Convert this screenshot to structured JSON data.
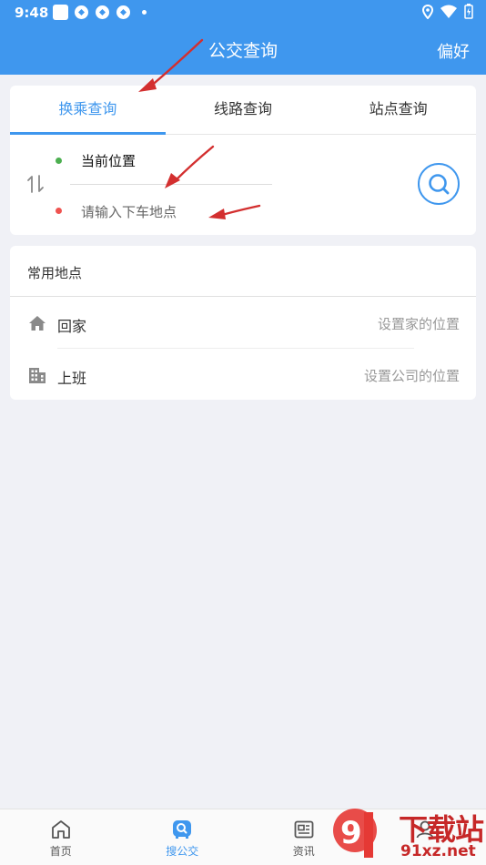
{
  "status": {
    "time": "9:48"
  },
  "header": {
    "title": "公交查询",
    "pref_button": "偏好"
  },
  "tabs": [
    {
      "label": "换乘查询",
      "active": true
    },
    {
      "label": "线路查询",
      "active": false
    },
    {
      "label": "站点查询",
      "active": false
    }
  ],
  "route": {
    "from": "当前位置",
    "to_placeholder": "请输入下车地点"
  },
  "places": {
    "title": "常用地点",
    "items": [
      {
        "icon": "home-icon",
        "label": "回家",
        "hint": "设置家的位置"
      },
      {
        "icon": "building-icon",
        "label": "上班",
        "hint": "设置公司的位置"
      }
    ]
  },
  "nav": [
    {
      "icon": "home-icon",
      "label": "首页",
      "active": false
    },
    {
      "icon": "bus-search-icon",
      "label": "搜公交",
      "active": true
    },
    {
      "icon": "news-icon",
      "label": "资讯",
      "active": false
    },
    {
      "icon": "profile-icon",
      "label": "",
      "active": false
    }
  ],
  "watermark": {
    "brand": "下载站",
    "domain": "91xz.net"
  },
  "colors": {
    "primary": "#3f97ee",
    "annotation": "#d32f2f"
  }
}
